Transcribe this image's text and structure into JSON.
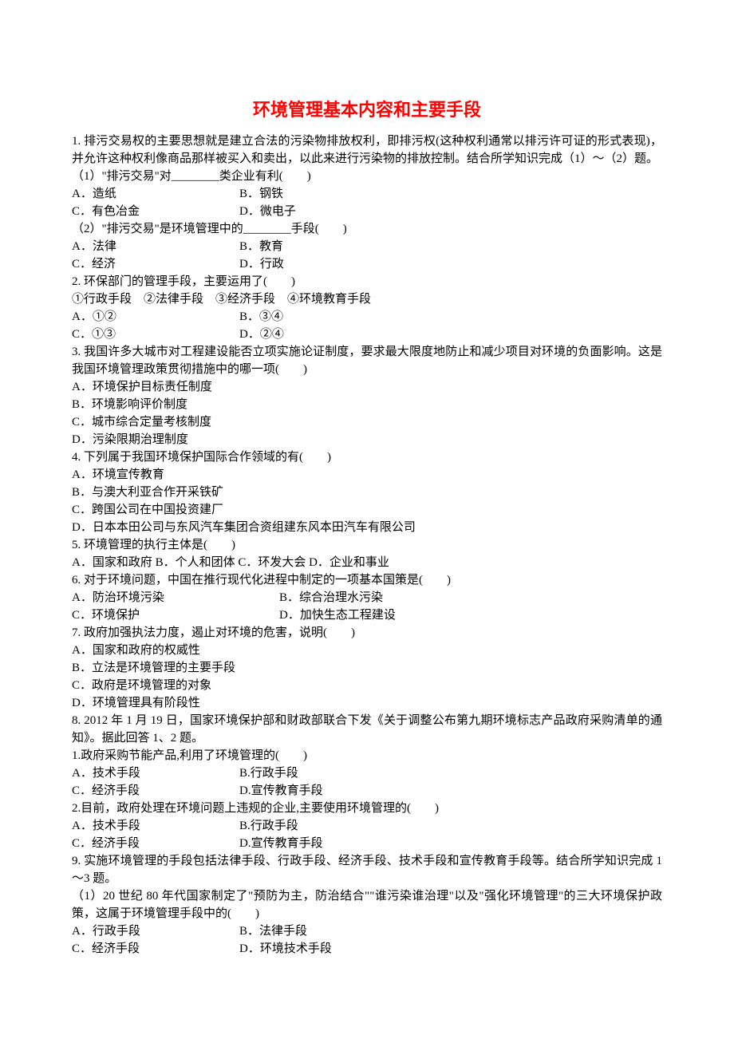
{
  "title": "环境管理基本内容和主要手段",
  "q1": {
    "num": "1.",
    "stem": "排污交易权的主要思想就是建立合法的污染物排放权利，即排污权(这种权利通常以排污许可证的形式表现)，并允许这种权利像商品那样被买入和卖出，以此来进行污染物的排放控制。结合所学知识完成（1）～（2）题。",
    "p1": {
      "stem": "（1）\"排污交易\"对________类企业有利(　　)",
      "a": "A．造纸",
      "b": "B．钢铁",
      "c": "C．有色冶金",
      "d": "D．微电子"
    },
    "p2": {
      "stem": "（2）\"排污交易\"是环境管理中的________手段(　　)",
      "a": "A．法律",
      "b": "B．教育",
      "c": "C．经济",
      "d": "D．行政"
    }
  },
  "q2": {
    "num": "2.",
    "stem": "环保部门的管理手段，主要运用了(　　)",
    "line": "①行政手段　②法律手段　③经济手段　④环境教育手段",
    "a": "A．①②",
    "b": "B．③④",
    "c": "C．①③",
    "d": "D．②④"
  },
  "q3": {
    "num": "3.",
    "stem": "我国许多大城市对工程建设能否立项实施论证制度，要求最大限度地防止和减少项目对环境的负面影响。这是我国环境管理政策贯彻措施中的哪一项(　　)",
    "a": "A．环境保护目标责任制度",
    "b": "B．环境影响评价制度",
    "c": "C．城市综合定量考核制度",
    "d": "D．污染限期治理制度"
  },
  "q4": {
    "num": "4.",
    "stem": "下列属于我国环境保护国际合作领域的有(　　)",
    "a": "A．环境宣传教育",
    "b": "B．与澳大利亚合作开采铁矿",
    "c": "C．跨国公司在中国投资建厂",
    "d": "D．日本本田公司与东风汽车集团合资组建东风本田汽车有限公司"
  },
  "q5": {
    "num": "5.",
    "stem": "环境管理的执行主体是(　　)",
    "opts": "A．国家和政府 B．个人和团体 C．环发大会 D．企业和事业"
  },
  "q6": {
    "num": "6.",
    "stem": "对于环境问题，中国在推行现代化进程中制定的一项基本国策是(　　)",
    "a": "A．防治环境污染",
    "b": "B．综合治理水污染",
    "c": "C．环境保护",
    "d": "D．加快生态工程建设"
  },
  "q7": {
    "num": "7.",
    "stem": "政府加强执法力度，遏止对环境的危害，说明(　　)",
    "a": "A．国家和政府的权威性",
    "b": "B．立法是环境管理的主要手段",
    "c": "C．政府是环境管理的对象",
    "d": "D．环境管理具有阶段性"
  },
  "q8": {
    "num": "8.",
    "stem": "2012 年 1 月 19 日，国家环境保护部和财政部联合下发《关于调整公布第九期环境标志产品政府采购清单的通知》。据此回答 1、2 题。",
    "p1": {
      "stem": "1.政府采购节能产品,利用了环境管理的(　　)",
      "a": "A．技术手段",
      "b": "B.行政手段",
      "c": "C．经济手段",
      "d": "D.宣传教育手段"
    },
    "p2": {
      "stem": "2.目前，政府处理在环境问题上违规的企业,主要使用环境管理的(　　)",
      "a": "A．技术手段",
      "b": "B.行政手段",
      "c": "C．经济手段",
      "d": "D.宣传教育手段"
    }
  },
  "q9": {
    "num": "9.",
    "stem": "实施环境管理的手段包括法律手段、行政手段、经济手段、技术手段和宣传教育手段等。结合所学知识完成 1～3 题。",
    "p1": {
      "stem": "（1）20 世纪 80 年代国家制定了\"预防为主，防治结合\"\"谁污染谁治理\"以及\"强化环境管理\"的三大环境保护政策，这属于环境管理手段中的(　　)",
      "a": "A．行政手段",
      "b": "B．法律手段",
      "c": "C．经济手段",
      "d": "D．环境技术手段"
    }
  }
}
